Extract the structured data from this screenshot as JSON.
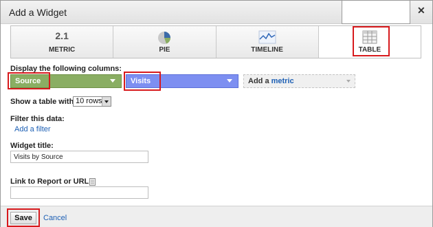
{
  "dialog": {
    "title": "Add a Widget"
  },
  "tabs": [
    {
      "label": "METRIC",
      "metric_value": "2.1"
    },
    {
      "label": "PIE"
    },
    {
      "label": "TIMELINE"
    },
    {
      "label": "TABLE"
    }
  ],
  "columns": {
    "heading": "Display the following columns:",
    "dimension": "Source",
    "metric": "Visits",
    "add_metric_prefix": "Add a",
    "add_metric_word": "metric"
  },
  "rows": {
    "label": "Show a table with",
    "value": "10 rows"
  },
  "filter": {
    "heading": "Filter this data:",
    "link": "Add a filter"
  },
  "widget_title": {
    "label": "Widget title:",
    "value": "Visits by Source"
  },
  "link_report": {
    "label": "Link to Report or URL:",
    "value": ""
  },
  "footer": {
    "save": "Save",
    "cancel": "Cancel"
  },
  "colors": {
    "dimension_pill": "#8aae63",
    "metric_pill": "#7d8ff1",
    "link": "#1c5fb4",
    "highlight": "#d7191c"
  }
}
